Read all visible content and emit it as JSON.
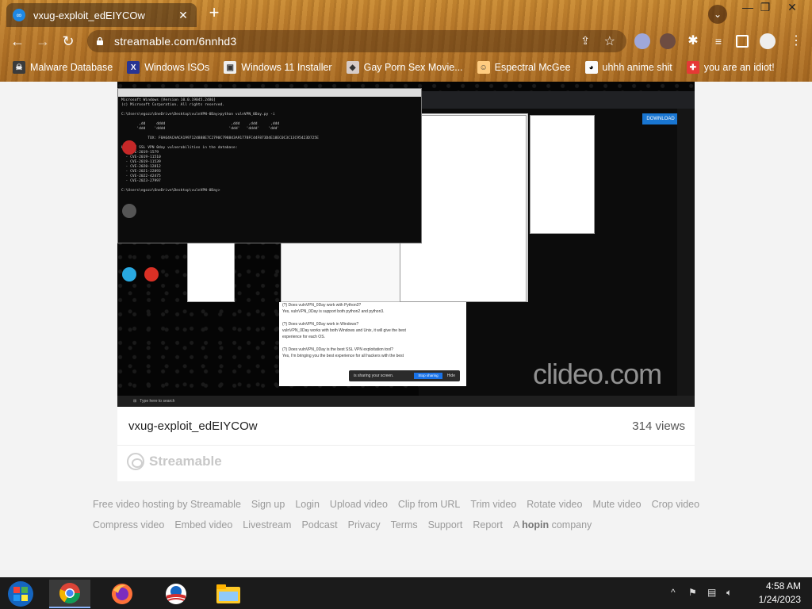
{
  "tab": {
    "title": "vxug-exploit_edEIYCOw",
    "close": "✕"
  },
  "window_controls": {
    "minimize": "—",
    "restore": "❐",
    "close": "✕"
  },
  "toolbar": {
    "url": "streamable.com/6nnhd3",
    "back": "←",
    "forward": "→",
    "reload": "↻",
    "new_tab": "+",
    "tab_search": "⌄"
  },
  "bookmarks": [
    {
      "label": "Malware Database",
      "icon": "skull-icon",
      "color": "#3b3b3b"
    },
    {
      "label": "Windows ISOs",
      "icon": "x-icon",
      "color": "#283593"
    },
    {
      "label": "Windows 11 Installer",
      "icon": "installer-icon",
      "color": "#6d4c41"
    },
    {
      "label": "Gay Porn Sex Movie...",
      "icon": "package-icon",
      "color": "#5d4037"
    },
    {
      "label": "Espectral McGee",
      "icon": "face-icon",
      "color": "#4e342e"
    },
    {
      "label": "uhhh anime shit",
      "icon": "anime-icon",
      "color": "#212121"
    },
    {
      "label": "you are an idiot!",
      "icon": "flag-icon",
      "color": "#b71c1c"
    }
  ],
  "video": {
    "watermark": "clideo.com",
    "share_bar": {
      "text": "is sharing your screen.",
      "stop": "Stop sharing",
      "hide": "Hide"
    },
    "download": "DOWNLOAD",
    "cmd_lines": [
      "Microsoft Windows [Version 10.0.19045.2486]",
      "(c) Microsoft Corporation. All rights reserved.",
      "",
      "C:\\Users\\egozz\\OneDrive\\Desktop\\vulnVPN-0Day>python vulnVPN_0Day.py -i",
      "",
      "        ,dd     dddd                              ,ddd    ,ddd      ,ddd",
      "       'ddd    'dddd                             'ddd'   'dddd'    'ddd'",
      "",
      "            TOX: F0A64ACAACA1997124888E7C2790C798843A91778FC44F873D4E18EC0C3C13C95423D725E",
      "",
      "List of SSL VPN 0day vulnerabilities in the database:",
      "  - CVE-2019-1579",
      "  - CVE-2019-11510",
      "  - CVE-2019-11539",
      "  - CVE-2020-12812",
      "  - CVE-2021-22893",
      "  - CVE-2022-42475",
      "  - CVE-2023-27997",
      "",
      "C:\\Users\\egozz\\OneDrive\\Desktop\\vulnVPN-0Day>"
    ],
    "doc_lines": [
      "(?) Does vulnVPN_0Day work with Python3?",
      "Yes, vulnVPN_0Day is support both python2 and python3.",
      "",
      "(?) Does vulnVPN_0Day work in Windows?",
      "vulnVPN_0Day works with both Windows and Unix, it will give the best",
      "experience for each OS.",
      "",
      "(?) Does vulnVPN_0Day is the best SSL VPN exploitation tool?",
      "Yes, I'm bringing you the best experience for all hackers with the best"
    ]
  },
  "video_info": {
    "title": "vxug-exploit_edEIYCOw",
    "views": "314 views",
    "brand": "Streamable"
  },
  "footer": {
    "row1": [
      "Free video hosting by Streamable",
      "Sign up",
      "Login",
      "Upload video",
      "Clip from URL",
      "Trim video",
      "Rotate video",
      "Mute video",
      "Crop video"
    ],
    "row2": [
      "Compress video",
      "Embed video",
      "Livestream",
      "Podcast",
      "Privacy",
      "Terms",
      "Support",
      "Report"
    ],
    "hopin_prefix": "A",
    "hopin_brand": "hopin",
    "hopin_suffix": "company"
  },
  "taskbar": {
    "time": "4:58 AM",
    "date": "1/24/2023",
    "show_hidden": "^"
  }
}
